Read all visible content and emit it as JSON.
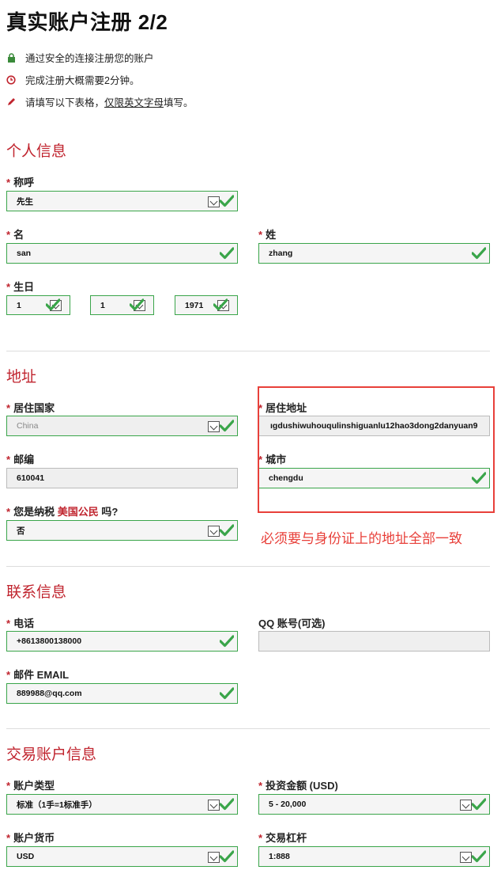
{
  "page_title": "真实账户注册 2/2",
  "info": [
    {
      "icon": "lock-icon",
      "text": "通过安全的连接注册您的账户"
    },
    {
      "icon": "clock-icon",
      "text": "完成注册大概需要2分钟。"
    },
    {
      "icon": "pencil-icon",
      "text_before": "请填写以下表格，",
      "link": "仅限英文字母",
      "text_after": "填写。"
    }
  ],
  "sections": {
    "personal": "个人信息",
    "address": "地址",
    "contact": "联系信息",
    "trading": "交易账户信息"
  },
  "personal": {
    "salutation_label": "称呼",
    "salutation_value": "先生",
    "first_label": "名",
    "first_value": "san",
    "last_label": "姓",
    "last_value": "zhang",
    "birthday_label": "生日",
    "day": "1",
    "month": "1",
    "year": "1971"
  },
  "address": {
    "country_label": "居住国家",
    "country_value": "China",
    "addr_label": "居住地址",
    "addr_value": "ıgdushiwuhouqulinshiguanlu12hao3dong2danyuan9",
    "zip_label": "邮编",
    "zip_value": "610041",
    "city_label": "城市",
    "city_value": "chengdu",
    "tax_label_a": "您是纳税",
    "tax_label_b": "美国公民",
    "tax_label_c": "吗?",
    "tax_value": "否",
    "note": "必须要与身份证上的地址全部一致"
  },
  "contact": {
    "phone_label": "电话",
    "phone_value": "+8613800138000",
    "qq_label": "QQ 账号(可选)",
    "qq_value": "",
    "email_label": "邮件 EMAIL",
    "email_value": "889988@qq.com"
  },
  "trading": {
    "type_label": "账户类型",
    "type_value": "标准（1手=1标准手）",
    "amount_label": "投资金额 (USD)",
    "amount_value": "5 - 20,000",
    "currency_label": "账户货币",
    "currency_value": "USD",
    "leverage_label": "交易杠杆",
    "leverage_value": "1:888"
  },
  "required_mark": "*",
  "colors": {
    "accent_red": "#c0242e",
    "valid_green": "#3aa54a",
    "annotation_red": "#e8403a"
  }
}
